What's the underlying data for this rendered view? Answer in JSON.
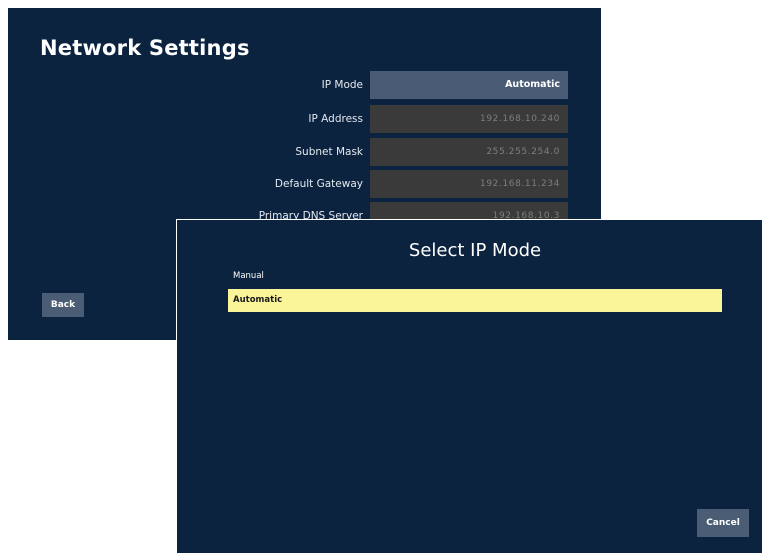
{
  "network_settings": {
    "title": "Network Settings",
    "rows": [
      {
        "label": "IP Mode",
        "value": "Automatic"
      },
      {
        "label": "IP Address",
        "value": "192.168.10.240"
      },
      {
        "label": "Subnet Mask",
        "value": "255.255.254.0"
      },
      {
        "label": "Default Gateway",
        "value": "192.168.11.234"
      },
      {
        "label": "Primary DNS Server",
        "value": "192.168.10.3"
      }
    ],
    "back_label": "Back"
  },
  "dialog": {
    "title": "Select IP Mode",
    "options": [
      "Manual",
      "Automatic"
    ],
    "selected_option": "Automatic",
    "cancel_label": "Cancel"
  },
  "colors": {
    "background": "#0c2340",
    "highlight": "#fbf59a",
    "button": "#4b5d74",
    "field": "#3a3a3a"
  }
}
